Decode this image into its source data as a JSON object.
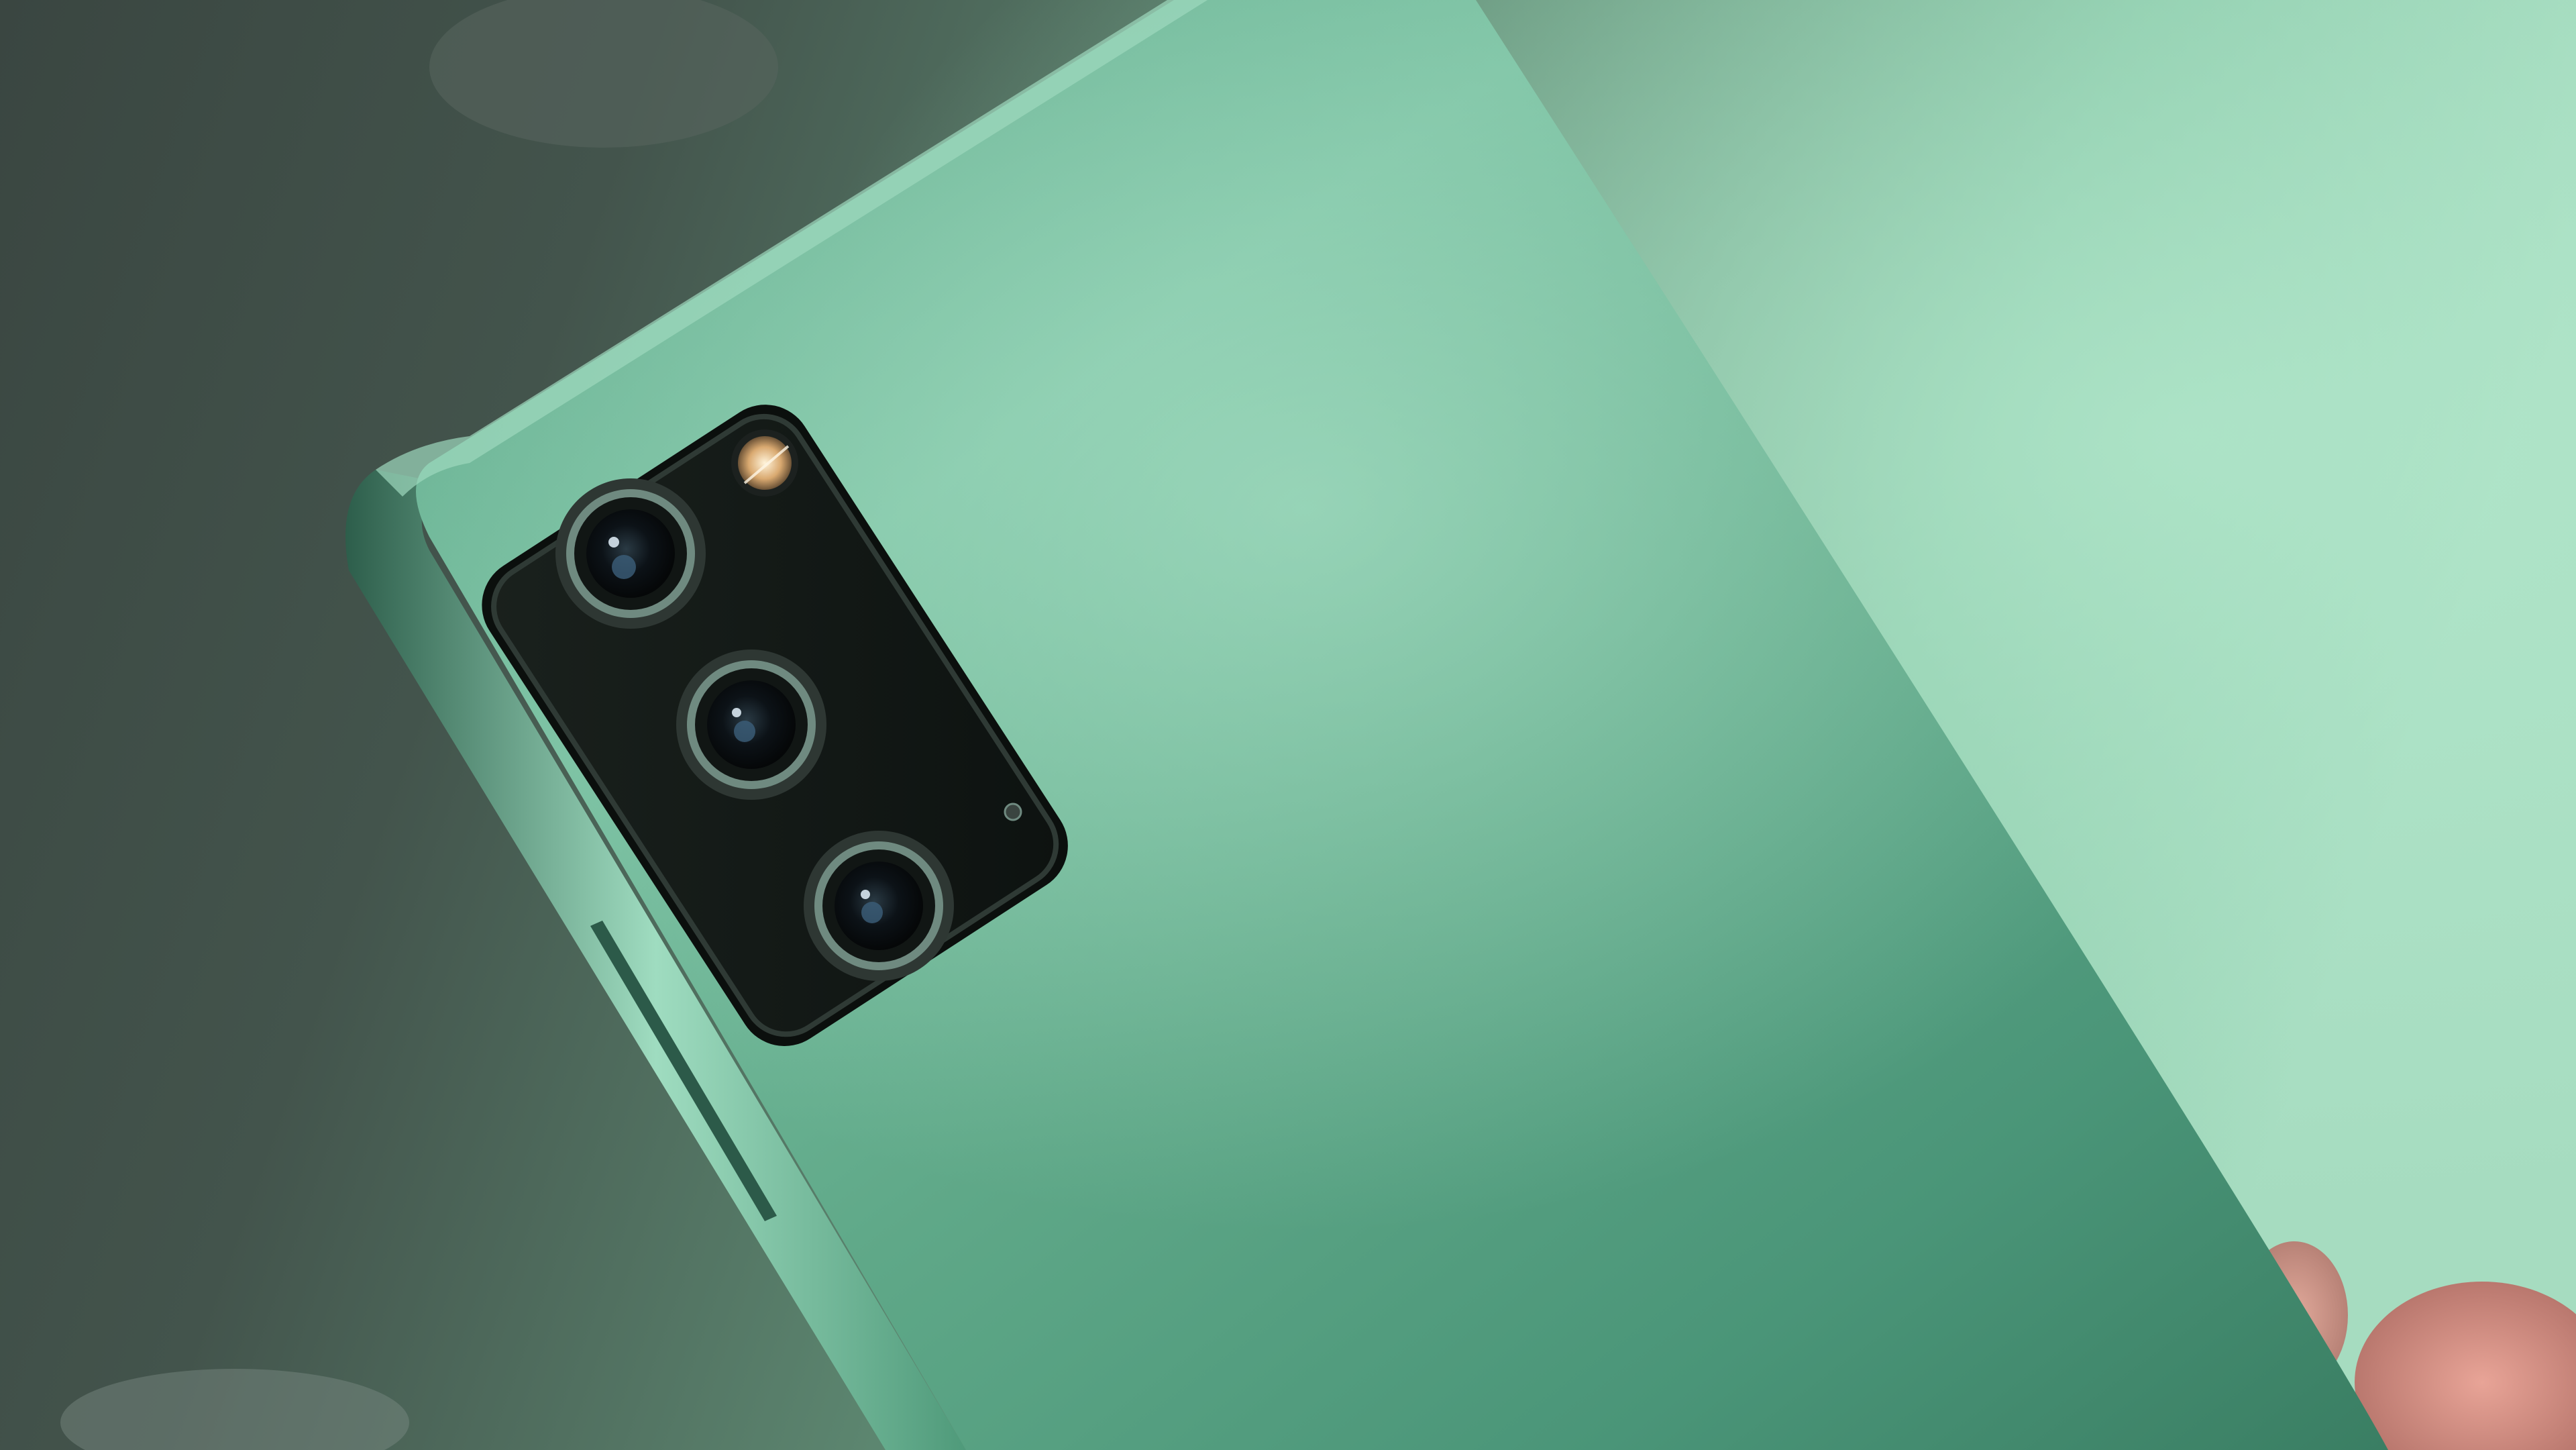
{
  "photo": {
    "subject": "smartphone-rear",
    "palette": {
      "background_left": "#37443e",
      "background_right": "#8fcfb0",
      "body_light": "#7fc6a6",
      "body_mid": "#4f9a7a",
      "body_dark": "#2e5f4c",
      "camera_module": "#121815",
      "lens_ring": "#2a2f2c",
      "flash": "#e8c79a",
      "finger": "#d48f85"
    },
    "lens_count": 3,
    "flash_visible": true
  }
}
